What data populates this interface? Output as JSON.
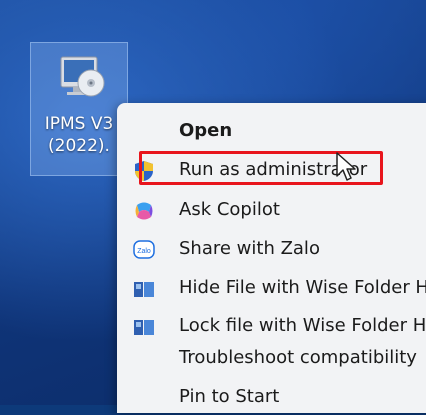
{
  "desktop": {
    "icon_label": "IPMS V3\n(2022)."
  },
  "context_menu": {
    "items": [
      {
        "label": "Open",
        "icon": "none",
        "bold": true
      },
      {
        "label": "Run as administrator",
        "icon": "uac-shield-icon"
      },
      {
        "label": "Ask Copilot",
        "icon": "copilot-icon"
      },
      {
        "label": "Share with Zalo",
        "icon": "zalo-icon"
      },
      {
        "label": "Hide File with Wise Folder H",
        "icon": "wise-folder-icon"
      },
      {
        "label": "Lock file with Wise Folder H",
        "icon": "wise-folder-icon"
      },
      {
        "label": "Troubleshoot compatibility",
        "icon": "none"
      },
      {
        "label": "Pin to Start",
        "icon": "none"
      }
    ]
  },
  "highlight": {
    "color": "#e8141c"
  }
}
